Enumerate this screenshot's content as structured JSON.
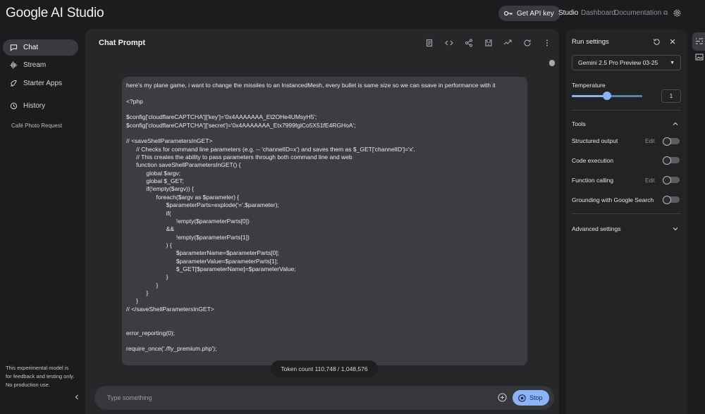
{
  "app": {
    "title": "Google AI Studio"
  },
  "topbar": {
    "api_key_label": "Get API key",
    "nav": {
      "studio": "Studio",
      "dashboard": "Dashboard",
      "documentation": "Documentation"
    }
  },
  "sidebar": {
    "items": [
      {
        "label": "Chat",
        "icon": "chat-icon",
        "active": true
      },
      {
        "label": "Stream",
        "icon": "stream-icon"
      },
      {
        "label": "Starter Apps",
        "icon": "starter-apps-icon"
      },
      {
        "label": "History",
        "icon": "history-icon"
      }
    ],
    "history_items": [
      "Café Photo Request"
    ],
    "disclaimer": "This experimental model is for feedback and testing only. No production use."
  },
  "chat": {
    "title": "Chat Prompt",
    "message": "here's my plane game, i want to change the missiles to an InstancedMesh, every bullet is same size so we can ssave in performance with it\n\n<?php\n\n$config['cloudflareCAPTCHA']['key']='0x4AAAAAAA_Et2OHe4UMsyH5';\n$config['cloudflareCAPTCHA']['secret']='0x4AAAAAAA_Etx7999fglCo5X51fE4RGHoA';\n\n// <saveShellParametersInGET>\n      // Checks for command line parameters (e.g. -- 'channelID=x') and saves them as $_GET['channelID']='x'.\n      // This creates the ability to pass parameters through both command line and web\n      function saveShellParametersInGET() {\n            global $argv;\n            global $_GET;\n            if(!empty($argv)) {\n                  foreach($argv as $parameter) {\n                        $parameterParts=explode('=',$parameter);\n                        if(\n                              !empty($parameterParts[0])\n                        &&\n                              !empty($parameterParts[1])\n                        ) {\n                              $parameterName=$parameterParts[0];\n                              $parameterValue=$parameterParts[1];\n                              $_GET[$parameterName]=$parameterValue;\n                        }\n                  }\n            }\n      }\n// </saveShellParametersInGET>\n\n\nerror_reporting(0);\n\nrequire_once('./fly_premium.php');",
    "token_count": "Token count 110,748 / 1,048,576",
    "input_placeholder": "Type something",
    "stop_label": "Stop"
  },
  "settings": {
    "title": "Run settings",
    "model": "Gemini 2.5 Pro Preview 03-25",
    "temperature_label": "Temperature",
    "temperature_value": "1",
    "temperature_fraction": 0.5,
    "tools_label": "Tools",
    "tools": [
      {
        "label": "Structured output",
        "edit": "Edit",
        "enabled": false
      },
      {
        "label": "Code execution",
        "enabled": false
      },
      {
        "label": "Function calling",
        "edit": "Edit",
        "enabled": false
      },
      {
        "label": "Grounding with Google Search",
        "enabled": false
      }
    ],
    "advanced_label": "Advanced settings"
  },
  "colors": {
    "accent": "#8ab4f8",
    "background": "#1b1c1e",
    "panel": "#262729",
    "message_bg": "#3c3d40"
  }
}
